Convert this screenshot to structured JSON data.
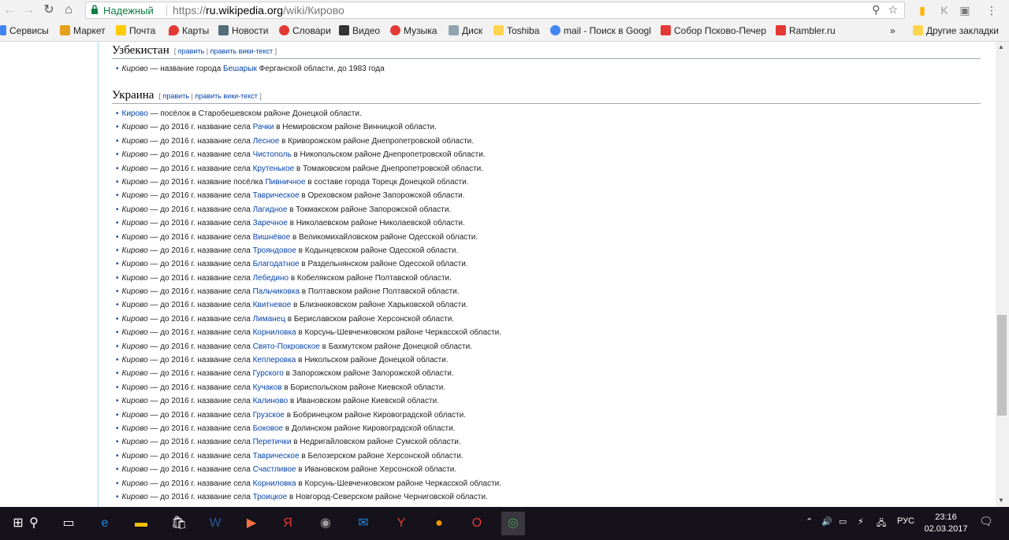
{
  "browser": {
    "secure_label": "Надежный",
    "url_scheme": "https://",
    "url_host": "ru.wikipedia.org",
    "url_path": "/wiki/Кирово",
    "zoom_icon": "magnifier-icon",
    "star_icon": "star-icon"
  },
  "bookmarks": [
    {
      "label": "Сервисы",
      "color": "#4285f4"
    },
    {
      "label": "Маркет",
      "color": "#e4a11b"
    },
    {
      "label": "Почта",
      "color": "#ffcc00"
    },
    {
      "label": "Карты",
      "color": "#e53935"
    },
    {
      "label": "Новости",
      "color": "#546e7a"
    },
    {
      "label": "Словари",
      "color": "#e53935"
    },
    {
      "label": "Видео",
      "color": "#333333"
    },
    {
      "label": "Музыка",
      "color": "#e53935"
    },
    {
      "label": "Диск",
      "color": "#90a4ae"
    },
    {
      "label": "Toshiba",
      "color": "#ffd54f"
    },
    {
      "label": "mail - Поиск в Googl",
      "color": "#4285f4"
    },
    {
      "label": "Собор Псково-Печер",
      "color": "#e53935"
    },
    {
      "label": "Rambler.ru",
      "color": "#e53935"
    },
    {
      "label": "»",
      "color": ""
    },
    {
      "label": "Другие закладки",
      "color": "#ffd54f"
    }
  ],
  "sections": [
    {
      "title": "Узбекистан",
      "edit_open": "[",
      "edit1": "править",
      "edit_sep": "|",
      "edit2": "править вики-текст",
      "edit_close": "]",
      "items": [
        {
          "pre": "Кирово",
          "pre_link": false,
          "mid": " — название города ",
          "link": "Бешарык",
          "post": " Ферганской области, до 1983 года"
        }
      ]
    },
    {
      "title": "Украина",
      "edit_open": "[",
      "edit1": "править",
      "edit_sep": "|",
      "edit2": "править вики-текст",
      "edit_close": "]",
      "items": [
        {
          "pre": "Кирово",
          "pre_link": true,
          "mid": " — посёлок в Старобешевском районе Донецкой области.",
          "link": "",
          "post": ""
        },
        {
          "pre": "Кирово",
          "pre_link": false,
          "mid": " — до 2016 г. название села ",
          "link": "Рачки",
          "post": " в Немировском районе Винницкой области."
        },
        {
          "pre": "Кирово",
          "pre_link": false,
          "mid": " — до 2016 г. название села ",
          "link": "Лесное",
          "post": " в Криворожском районе Днепропетровской области."
        },
        {
          "pre": "Кирово",
          "pre_link": false,
          "mid": " — до 2016 г. название села ",
          "link": "Чистополь",
          "post": " в Никопольском районе Днепропетровской области."
        },
        {
          "pre": "Кирово",
          "pre_link": false,
          "mid": " — до 2016 г. название села ",
          "link": "Крутенькое",
          "post": " в Томаковском районе Днепропетровской области."
        },
        {
          "pre": "Кирово",
          "pre_link": false,
          "mid": " — до 2016 г. название посёлка ",
          "link": "Пивничное",
          "post": " в составе города Торецк Донецкой области."
        },
        {
          "pre": "Кирово",
          "pre_link": false,
          "mid": " — до 2016 г. название села ",
          "link": "Таврическое",
          "post": " в Ореховском районе Запорожской области."
        },
        {
          "pre": "Кирово",
          "pre_link": false,
          "mid": " — до 2016 г. название села ",
          "link": "Лагидное",
          "post": " в Токмакском районе Запорожской области."
        },
        {
          "pre": "Кирово",
          "pre_link": false,
          "mid": " — до 2016 г. название села ",
          "link": "Заречное",
          "post": " в Николаевском районе Николаевской области."
        },
        {
          "pre": "Кирово",
          "pre_link": false,
          "mid": " — до 2016 г. название села ",
          "link": "Вишнёвое",
          "post": " в Великомихайловском районе Одесской области."
        },
        {
          "pre": "Кирово",
          "pre_link": false,
          "mid": " — до 2016 г. название села ",
          "link": "Трояндовое",
          "post": " в Кодынцевском районе Одесской области."
        },
        {
          "pre": "Кирово",
          "pre_link": false,
          "mid": " — до 2016 г. название села ",
          "link": "Благодатное",
          "post": " в Раздельнянском районе Одесской области."
        },
        {
          "pre": "Кирово",
          "pre_link": false,
          "mid": " — до 2016 г. название села ",
          "link": "Лебедино",
          "post": " в Кобелякском районе Полтавской области."
        },
        {
          "pre": "Кирово",
          "pre_link": false,
          "mid": " — до 2016 г. название села ",
          "link": "Пальчиковка",
          "post": " в Полтавском районе Полтавской области."
        },
        {
          "pre": "Кирово",
          "pre_link": false,
          "mid": " — до 2016 г. название села ",
          "link": "Квитневое",
          "post": " в Близнюковском районе Харьковской области."
        },
        {
          "pre": "Кирово",
          "pre_link": false,
          "mid": " — до 2016 г. название села ",
          "link": "Лиманец",
          "post": " в Бериславском районе Херсонской области."
        },
        {
          "pre": "Кирово",
          "pre_link": false,
          "mid": " — до 2016 г. название села ",
          "link": "Корниловка",
          "post": " в Корсунь-Шевченковском районе Черкасской области."
        },
        {
          "pre": "Кирово",
          "pre_link": false,
          "mid": " — до 2016 г. название села ",
          "link": "Свято-Покровское",
          "post": " в Бахмутском районе Донецкой области."
        },
        {
          "pre": "Кирово",
          "pre_link": false,
          "mid": " — до 2016 г. название села ",
          "link": "Кеплеровка",
          "post": " в Никольском районе Донецкой области."
        },
        {
          "pre": "Кирово",
          "pre_link": false,
          "mid": " — до 2016 г. название села ",
          "link": "Гурского",
          "post": " в Запорожском районе Запорожской области."
        },
        {
          "pre": "Кирово",
          "pre_link": false,
          "mid": " — до 2016 г. название села ",
          "link": "Кучаков",
          "post": " в Бориспольском районе Киевской области."
        },
        {
          "pre": "Кирово",
          "pre_link": false,
          "mid": " — до 2016 г. название села ",
          "link": "Калиново",
          "post": " в Ивановском районе Киевской области."
        },
        {
          "pre": "Кирово",
          "pre_link": false,
          "mid": " — до 2016 г. название села ",
          "link": "Грузское",
          "post": " в Бобринецком районе Кировоградской области."
        },
        {
          "pre": "Кирово",
          "pre_link": false,
          "mid": " — до 2016 г. название села ",
          "link": "Боковое",
          "post": " в Долинском районе Кировоградской области."
        },
        {
          "pre": "Кирово",
          "pre_link": false,
          "mid": " — до 2016 г. название села ",
          "link": "Перетички",
          "post": " в Недригайловском районе Сумской области."
        },
        {
          "pre": "Кирово",
          "pre_link": false,
          "mid": " — до 2016 г. название села ",
          "link": "Таврическое",
          "post": " в Белозерском районе Херсонской области."
        },
        {
          "pre": "Кирово",
          "pre_link": false,
          "mid": " — до 2016 г. название села ",
          "link": "Счастливое",
          "post": " в Ивановском районе Херсонской области."
        },
        {
          "pre": "Кирово",
          "pre_link": false,
          "mid": " — до 2016 г. название села ",
          "link": "Корниловка",
          "post": " в Корсунь-Шевченковском районе Черкасской области."
        },
        {
          "pre": "Кирово",
          "pre_link": false,
          "mid": " — до 2016 г. название села ",
          "link": "Троицкое",
          "post": " в Новгород-Северском районе Черниговской области."
        }
      ]
    }
  ],
  "taskbar": {
    "apps": [
      {
        "name": "start-icon",
        "glyph": "⊞",
        "color": "#ffffff"
      },
      {
        "name": "search-icon",
        "glyph": "⚲",
        "color": "#ffffff"
      },
      {
        "name": "task-view-icon",
        "glyph": "▭",
        "color": "#ffffff"
      },
      {
        "name": "edge-icon",
        "glyph": "e",
        "color": "#1e88e5"
      },
      {
        "name": "file-explorer-icon",
        "glyph": "▬",
        "color": "#ffc107"
      },
      {
        "name": "store-icon",
        "glyph": "🛍",
        "color": "#ffffff"
      },
      {
        "name": "word-icon",
        "glyph": "W",
        "color": "#2b579a"
      },
      {
        "name": "media-icon",
        "glyph": "▶",
        "color": "#ff7043"
      },
      {
        "name": "yandex-icon",
        "glyph": "Я",
        "color": "#e53935"
      },
      {
        "name": "disc-icon",
        "glyph": "◉",
        "color": "#9e9e9e"
      },
      {
        "name": "mail-icon",
        "glyph": "✉",
        "color": "#1e88e5"
      },
      {
        "name": "yandex-browser-icon",
        "glyph": "Y",
        "color": "#e53935"
      },
      {
        "name": "toolbox-icon",
        "glyph": "●",
        "color": "#ff9800"
      },
      {
        "name": "opera-icon",
        "glyph": "O",
        "color": "#e53935"
      },
      {
        "name": "chrome-icon",
        "glyph": "◎",
        "color": "#43a047"
      }
    ],
    "lang": "РУС",
    "time": "23:16",
    "date": "02.03.2017"
  }
}
